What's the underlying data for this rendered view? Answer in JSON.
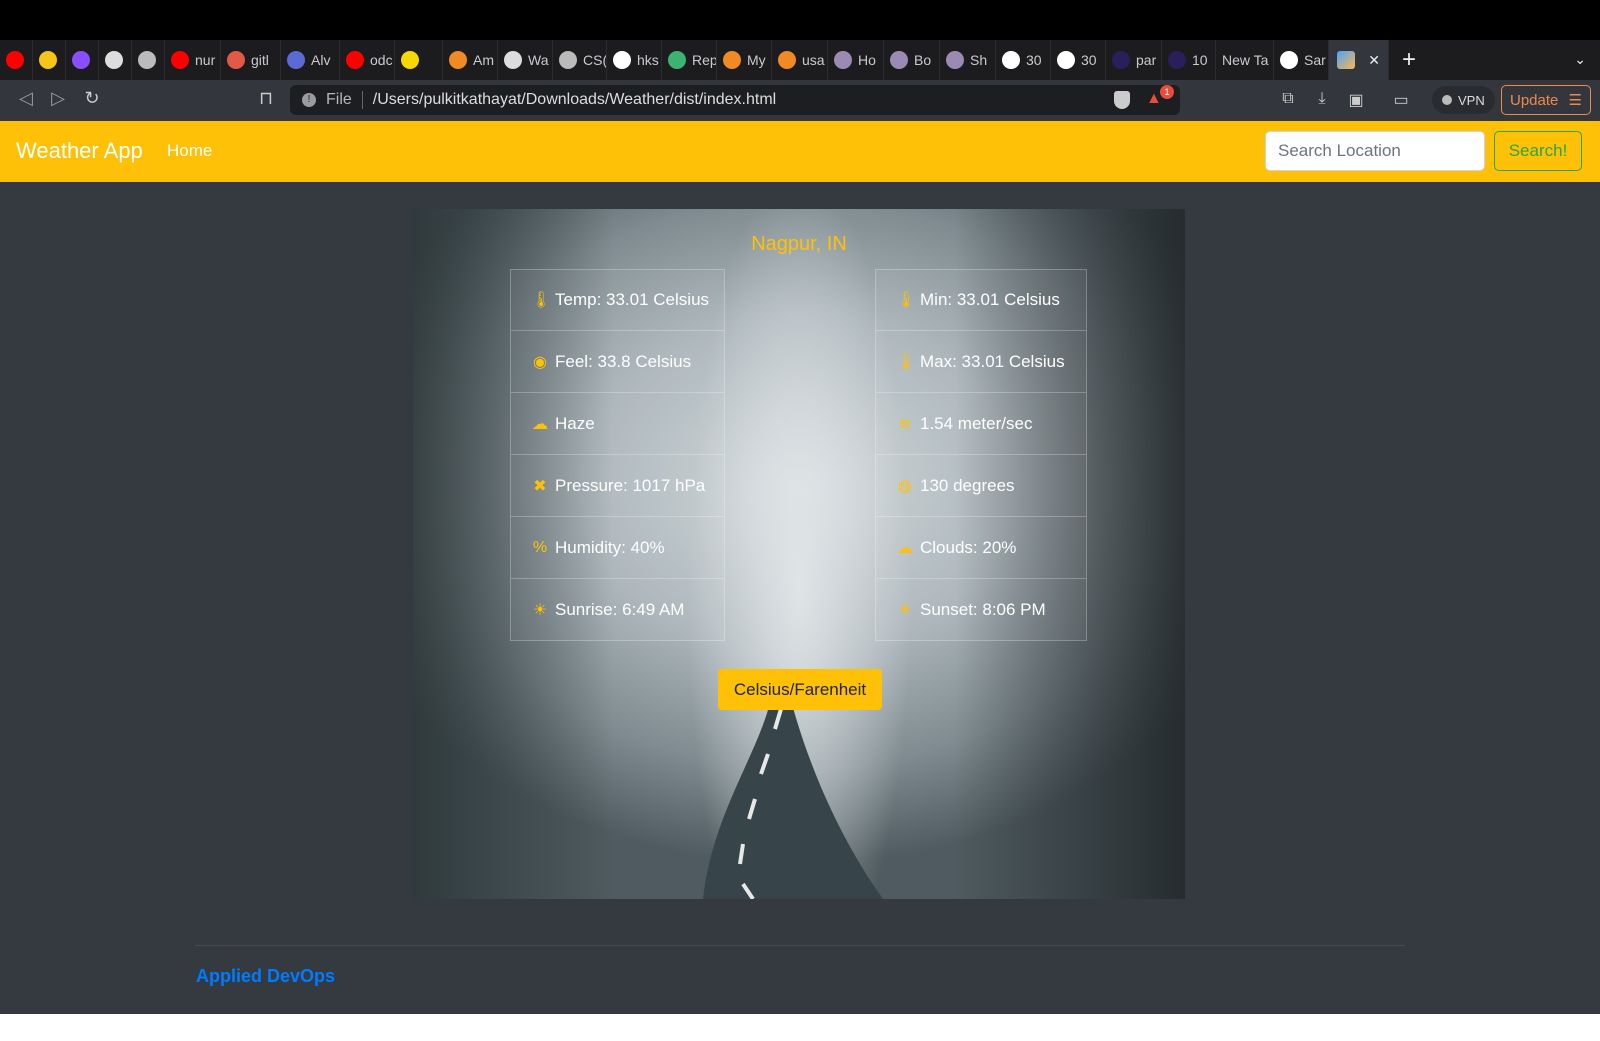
{
  "browser": {
    "tabs": [
      {
        "label": "",
        "color": "#ff0000"
      },
      {
        "label": "",
        "color": "#f5c518"
      },
      {
        "label": "",
        "color": "#8a4dff"
      },
      {
        "label": "",
        "color": "#dddddd"
      },
      {
        "label": "",
        "color": "#bbbbbb"
      },
      {
        "label": "nur",
        "color": "#ff0000"
      },
      {
        "label": "gitl",
        "color": "#e05a47"
      },
      {
        "label": "Alv",
        "color": "#5b6bd6"
      },
      {
        "label": "odc",
        "color": "#ff0000"
      },
      {
        "label": "",
        "color": "#f5d800"
      },
      {
        "label": "Am",
        "color": "#f08a24"
      },
      {
        "label": "Wa",
        "color": "#dddddd"
      },
      {
        "label": "CS(",
        "color": "#bbbbbb"
      },
      {
        "label": "hks",
        "color": "#ffffff"
      },
      {
        "label": "Rep",
        "color": "#3cb371"
      },
      {
        "label": "My",
        "color": "#f08a24"
      },
      {
        "label": "usa",
        "color": "#f08a24"
      },
      {
        "label": "Ho",
        "color": "#9b8bb4"
      },
      {
        "label": "Bo",
        "color": "#9b8bb4"
      },
      {
        "label": "Sh",
        "color": "#9b8bb4"
      },
      {
        "label": "30",
        "color": "#ffffff"
      },
      {
        "label": "30",
        "color": "#ffffff"
      },
      {
        "label": "par",
        "color": "#2a1f5a"
      },
      {
        "label": "10",
        "color": "#2a1f5a"
      },
      {
        "label": "New Ta",
        "color": ""
      },
      {
        "label": "Sar",
        "color": "#ffffff"
      }
    ],
    "active_tab_close": "✕",
    "new_tab": "+",
    "tab_menu": "⌄",
    "url_scheme": "File",
    "url": "/Users/pulkitkathayat/Downloads/Weather/dist/index.html",
    "notification_count": "1",
    "vpn_label": "VPN",
    "update_label": "Update"
  },
  "navbar": {
    "brand": "Weather App",
    "home": "Home",
    "search_placeholder": "Search Location",
    "search_button": "Search!",
    "accent": "#ffc107"
  },
  "weather": {
    "city": "Nagpur, IN",
    "left": [
      {
        "icon": "thermometer-icon",
        "glyph": "🌡",
        "text": "Temp: 33.01 Celsius"
      },
      {
        "icon": "feel-icon",
        "glyph": "◉",
        "text": "Feel: 33.8 Celsius"
      },
      {
        "icon": "haze-icon",
        "glyph": "☁",
        "text": "Haze"
      },
      {
        "icon": "pressure-icon",
        "glyph": "✖",
        "text": "Pressure: 1017 hPa"
      },
      {
        "icon": "humidity-icon",
        "glyph": "%",
        "text": "Humidity: 40%"
      },
      {
        "icon": "sunrise-icon",
        "glyph": "☀",
        "text": "Sunrise: 6:49 AM"
      }
    ],
    "right": [
      {
        "icon": "min-temp-icon",
        "glyph": "🌡",
        "text": "Min: 33.01 Celsius"
      },
      {
        "icon": "max-temp-icon",
        "glyph": "🌡",
        "text": "Max: 33.01 Celsius"
      },
      {
        "icon": "wind-icon",
        "glyph": "≋",
        "text": "1.54 meter/sec"
      },
      {
        "icon": "direction-icon",
        "glyph": "◍",
        "text": "130 degrees"
      },
      {
        "icon": "clouds-icon",
        "glyph": "☁",
        "text": "Clouds: 20%"
      },
      {
        "icon": "sunset-icon",
        "glyph": "☀",
        "text": "Sunset: 8:06 PM"
      }
    ],
    "toggle_button": "Celsius/Farenheit"
  },
  "footer": {
    "link": "Applied DevOps",
    "link_color": "#007bff"
  }
}
